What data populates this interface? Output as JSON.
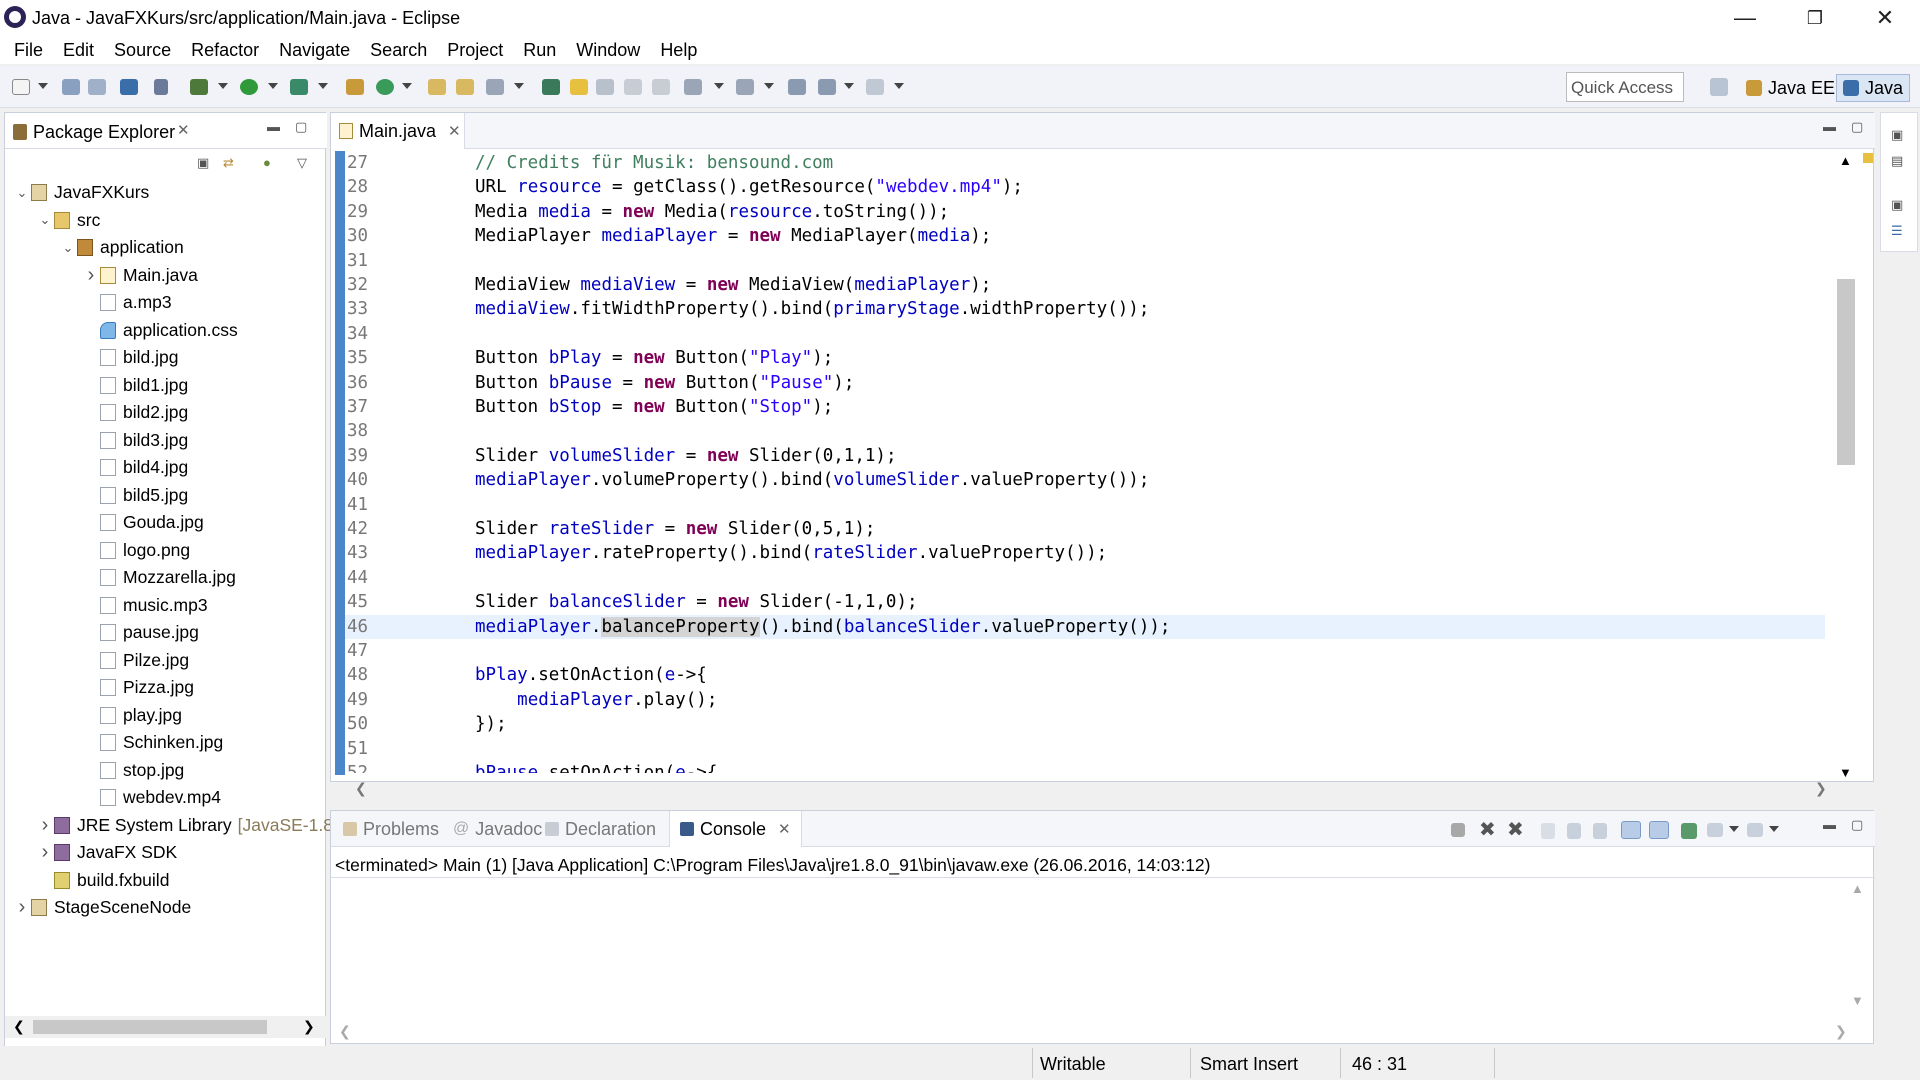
{
  "window": {
    "title": "Java - JavaFXKurs/src/application/Main.java - Eclipse"
  },
  "menu": [
    "File",
    "Edit",
    "Source",
    "Refactor",
    "Navigate",
    "Search",
    "Project",
    "Run",
    "Window",
    "Help"
  ],
  "toolbar": {
    "quick_access_placeholder": "Quick Access",
    "perspectives": [
      "Java EE",
      "Java"
    ]
  },
  "package_explorer": {
    "title": "Package Explorer",
    "tree": [
      {
        "label": "JavaFXKurs",
        "level": 0,
        "icon": "project",
        "expanded": true
      },
      {
        "label": "src",
        "level": 1,
        "icon": "source-folder",
        "expanded": true
      },
      {
        "label": "application",
        "level": 2,
        "icon": "package",
        "expanded": true
      },
      {
        "label": "Main.java",
        "level": 3,
        "icon": "java-file",
        "expanded": false
      },
      {
        "label": "a.mp3",
        "level": 3,
        "icon": "file"
      },
      {
        "label": "application.css",
        "level": 3,
        "icon": "css-file"
      },
      {
        "label": "bild.jpg",
        "level": 3,
        "icon": "file"
      },
      {
        "label": "bild1.jpg",
        "level": 3,
        "icon": "file"
      },
      {
        "label": "bild2.jpg",
        "level": 3,
        "icon": "file"
      },
      {
        "label": "bild3.jpg",
        "level": 3,
        "icon": "file"
      },
      {
        "label": "bild4.jpg",
        "level": 3,
        "icon": "file"
      },
      {
        "label": "bild5.jpg",
        "level": 3,
        "icon": "file"
      },
      {
        "label": "Gouda.jpg",
        "level": 3,
        "icon": "file"
      },
      {
        "label": "logo.png",
        "level": 3,
        "icon": "file"
      },
      {
        "label": "Mozzarella.jpg",
        "level": 3,
        "icon": "file"
      },
      {
        "label": "music.mp3",
        "level": 3,
        "icon": "file"
      },
      {
        "label": "pause.jpg",
        "level": 3,
        "icon": "file"
      },
      {
        "label": "Pilze.jpg",
        "level": 3,
        "icon": "file"
      },
      {
        "label": "Pizza.jpg",
        "level": 3,
        "icon": "file"
      },
      {
        "label": "play.jpg",
        "level": 3,
        "icon": "file"
      },
      {
        "label": "Schinken.jpg",
        "level": 3,
        "icon": "file"
      },
      {
        "label": "stop.jpg",
        "level": 3,
        "icon": "file"
      },
      {
        "label": "webdev.mp4",
        "level": 3,
        "icon": "file"
      },
      {
        "label": "JRE System Library",
        "suffix": "[JavaSE-1.8",
        "level": 1,
        "icon": "library",
        "expanded": false
      },
      {
        "label": "JavaFX SDK",
        "level": 1,
        "icon": "library",
        "expanded": false
      },
      {
        "label": "build.fxbuild",
        "level": 1,
        "icon": "fxbuild-file"
      },
      {
        "label": "StageSceneNode",
        "level": 0,
        "icon": "project",
        "expanded": false
      }
    ]
  },
  "editor": {
    "tab": "Main.java",
    "current_line": 46,
    "lines": [
      {
        "no": "27",
        "text": "// Credits für Musik: bensound.com"
      },
      {
        "no": "28",
        "text": "URL resource = getClass().getResource(\"webdev.mp4\");"
      },
      {
        "no": "29",
        "text": "Media media = new Media(resource.toString());"
      },
      {
        "no": "30",
        "text": "MediaPlayer mediaPlayer = new MediaPlayer(media);"
      },
      {
        "no": "31",
        "text": ""
      },
      {
        "no": "32",
        "text": "MediaView mediaView = new MediaView(mediaPlayer);"
      },
      {
        "no": "33",
        "text": "mediaView.fitWidthProperty().bind(primaryStage.widthProperty());"
      },
      {
        "no": "34",
        "text": ""
      },
      {
        "no": "35",
        "text": "Button bPlay = new Button(\"Play\");"
      },
      {
        "no": "36",
        "text": "Button bPause = new Button(\"Pause\");"
      },
      {
        "no": "37",
        "text": "Button bStop = new Button(\"Stop\");"
      },
      {
        "no": "38",
        "text": ""
      },
      {
        "no": "39",
        "text": "Slider volumeSlider = new Slider(0,1,1);"
      },
      {
        "no": "40",
        "text": "mediaPlayer.volumeProperty().bind(volumeSlider.valueProperty());"
      },
      {
        "no": "41",
        "text": ""
      },
      {
        "no": "42",
        "text": "Slider rateSlider = new Slider(0,5,1);"
      },
      {
        "no": "43",
        "text": "mediaPlayer.rateProperty().bind(rateSlider.valueProperty());"
      },
      {
        "no": "44",
        "text": ""
      },
      {
        "no": "45",
        "text": "Slider balanceSlider = new Slider(-1,1,0);"
      },
      {
        "no": "46",
        "text": "mediaPlayer.balanceProperty().bind(balanceSlider.valueProperty());"
      },
      {
        "no": "47",
        "text": ""
      },
      {
        "no": "48",
        "text": "bPlay.setOnAction(e->{"
      },
      {
        "no": "49",
        "text": "    mediaPlayer.play();"
      },
      {
        "no": "50",
        "text": "});"
      },
      {
        "no": "51",
        "text": ""
      },
      {
        "no": "52",
        "text": "bPause.setOnAction(e->{"
      }
    ]
  },
  "bottom_panel": {
    "tabs": [
      "Problems",
      "Javadoc",
      "Declaration",
      "Console"
    ],
    "active_tab": "Console",
    "console_description": "<terminated> Main (1) [Java Application] C:\\Program Files\\Java\\jre1.8.0_91\\bin\\javaw.exe (26.06.2016, 14:03:12)"
  },
  "status_bar": {
    "mode": "Writable",
    "insert": "Smart Insert",
    "position": "46 : 31"
  },
  "colors": {
    "keyword": "#7f0055",
    "string": "#2a00ff",
    "comment": "#3f7f5f",
    "field": "#0000c0",
    "current_line": "#e8f2fe",
    "ruler": "#4a86c8"
  }
}
